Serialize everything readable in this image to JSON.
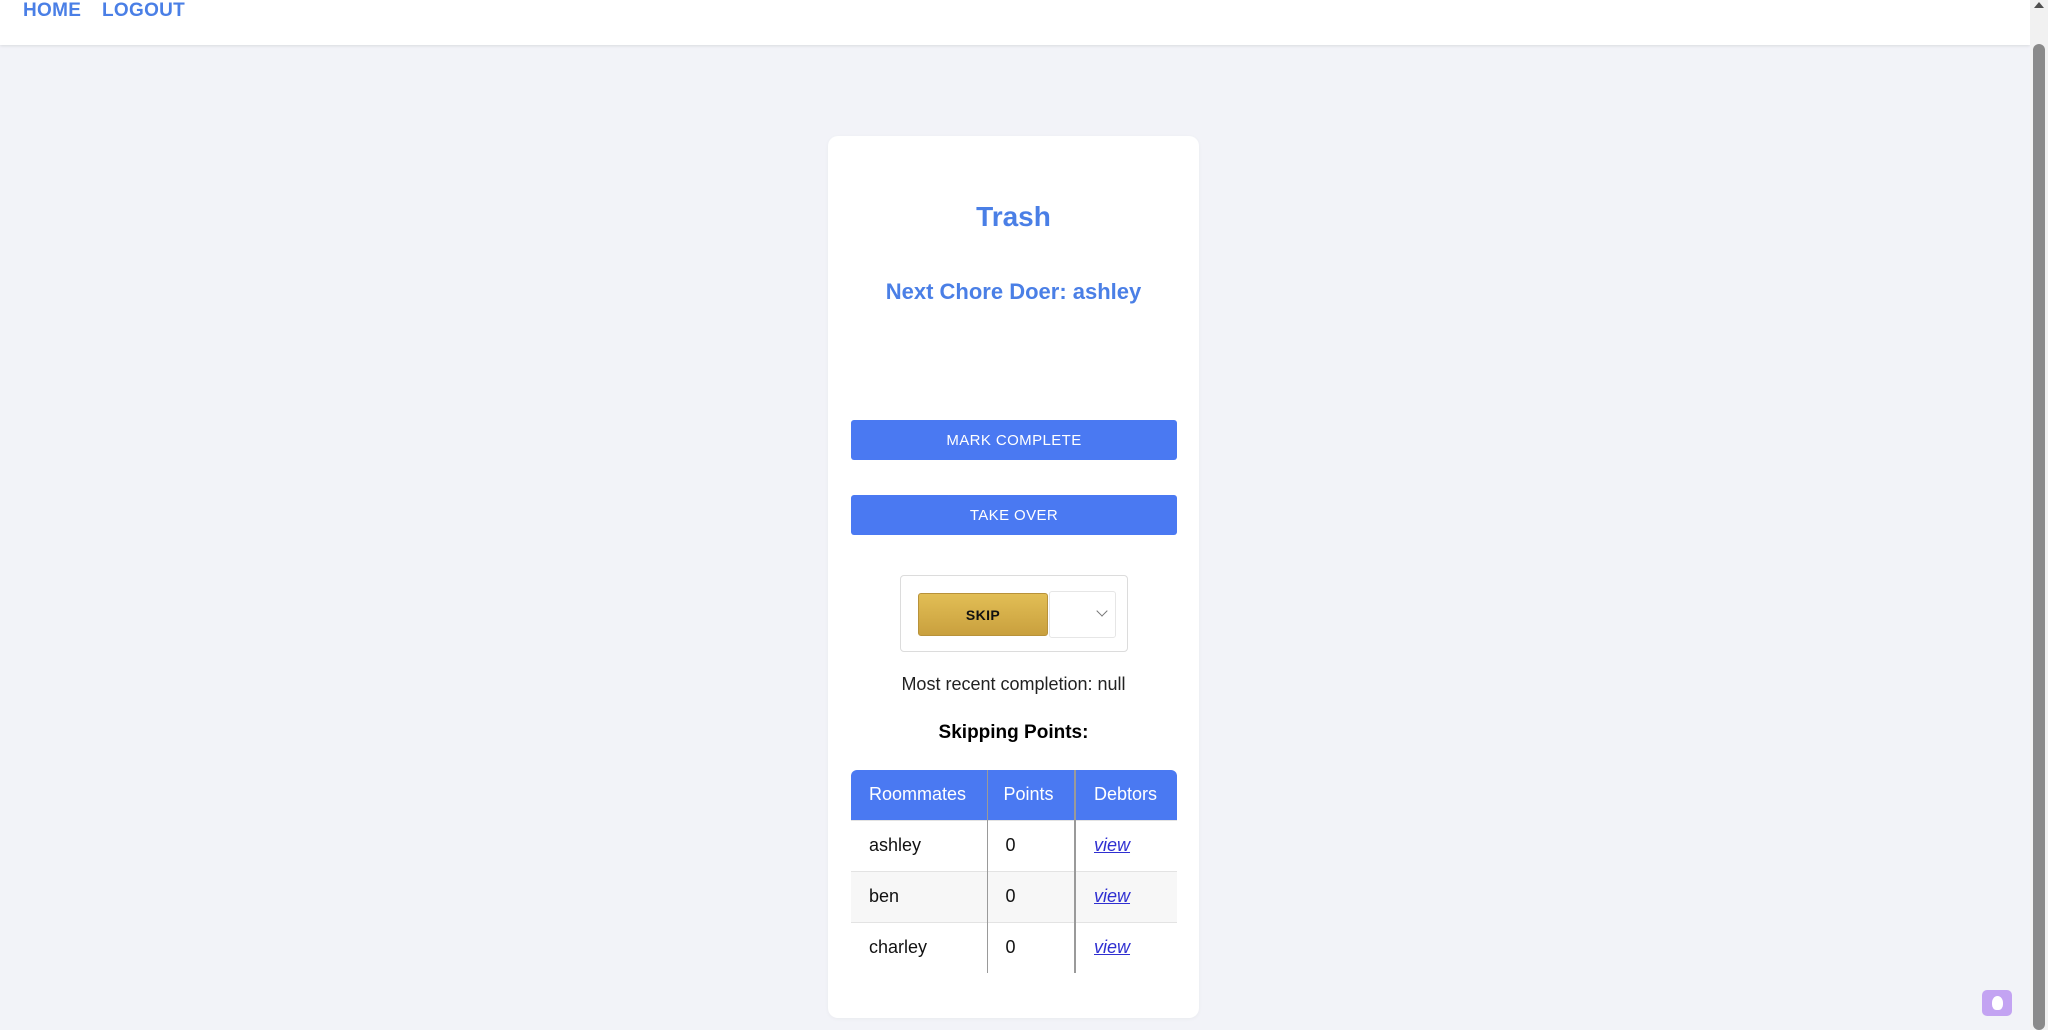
{
  "nav": {
    "home": "HOME",
    "logout": "LOGOUT"
  },
  "chore": {
    "title": "Trash",
    "next_doer": "Next Chore Doer: ashley",
    "mark_complete": "MARK COMPLETE",
    "take_over": "TAKE OVER",
    "skip": "SKIP",
    "recent_completion": "Most recent completion: null",
    "points_heading": "Skipping Points:"
  },
  "table": {
    "headers": [
      "Roommates",
      "Points",
      "Debtors"
    ],
    "rows": [
      {
        "name": "ashley",
        "points": "0",
        "debtors": "view"
      },
      {
        "name": "ben",
        "points": "0",
        "debtors": "view"
      },
      {
        "name": "charley",
        "points": "0",
        "debtors": "view"
      }
    ]
  },
  "colors": {
    "accent": "#4a7fe6",
    "button": "#4a79f2",
    "skip_button": "#d4ae4a",
    "background": "#f2f3f8"
  },
  "icons": [
    "chevron-down-icon",
    "scroll-up-arrow-icon",
    "extension-flame-icon"
  ]
}
